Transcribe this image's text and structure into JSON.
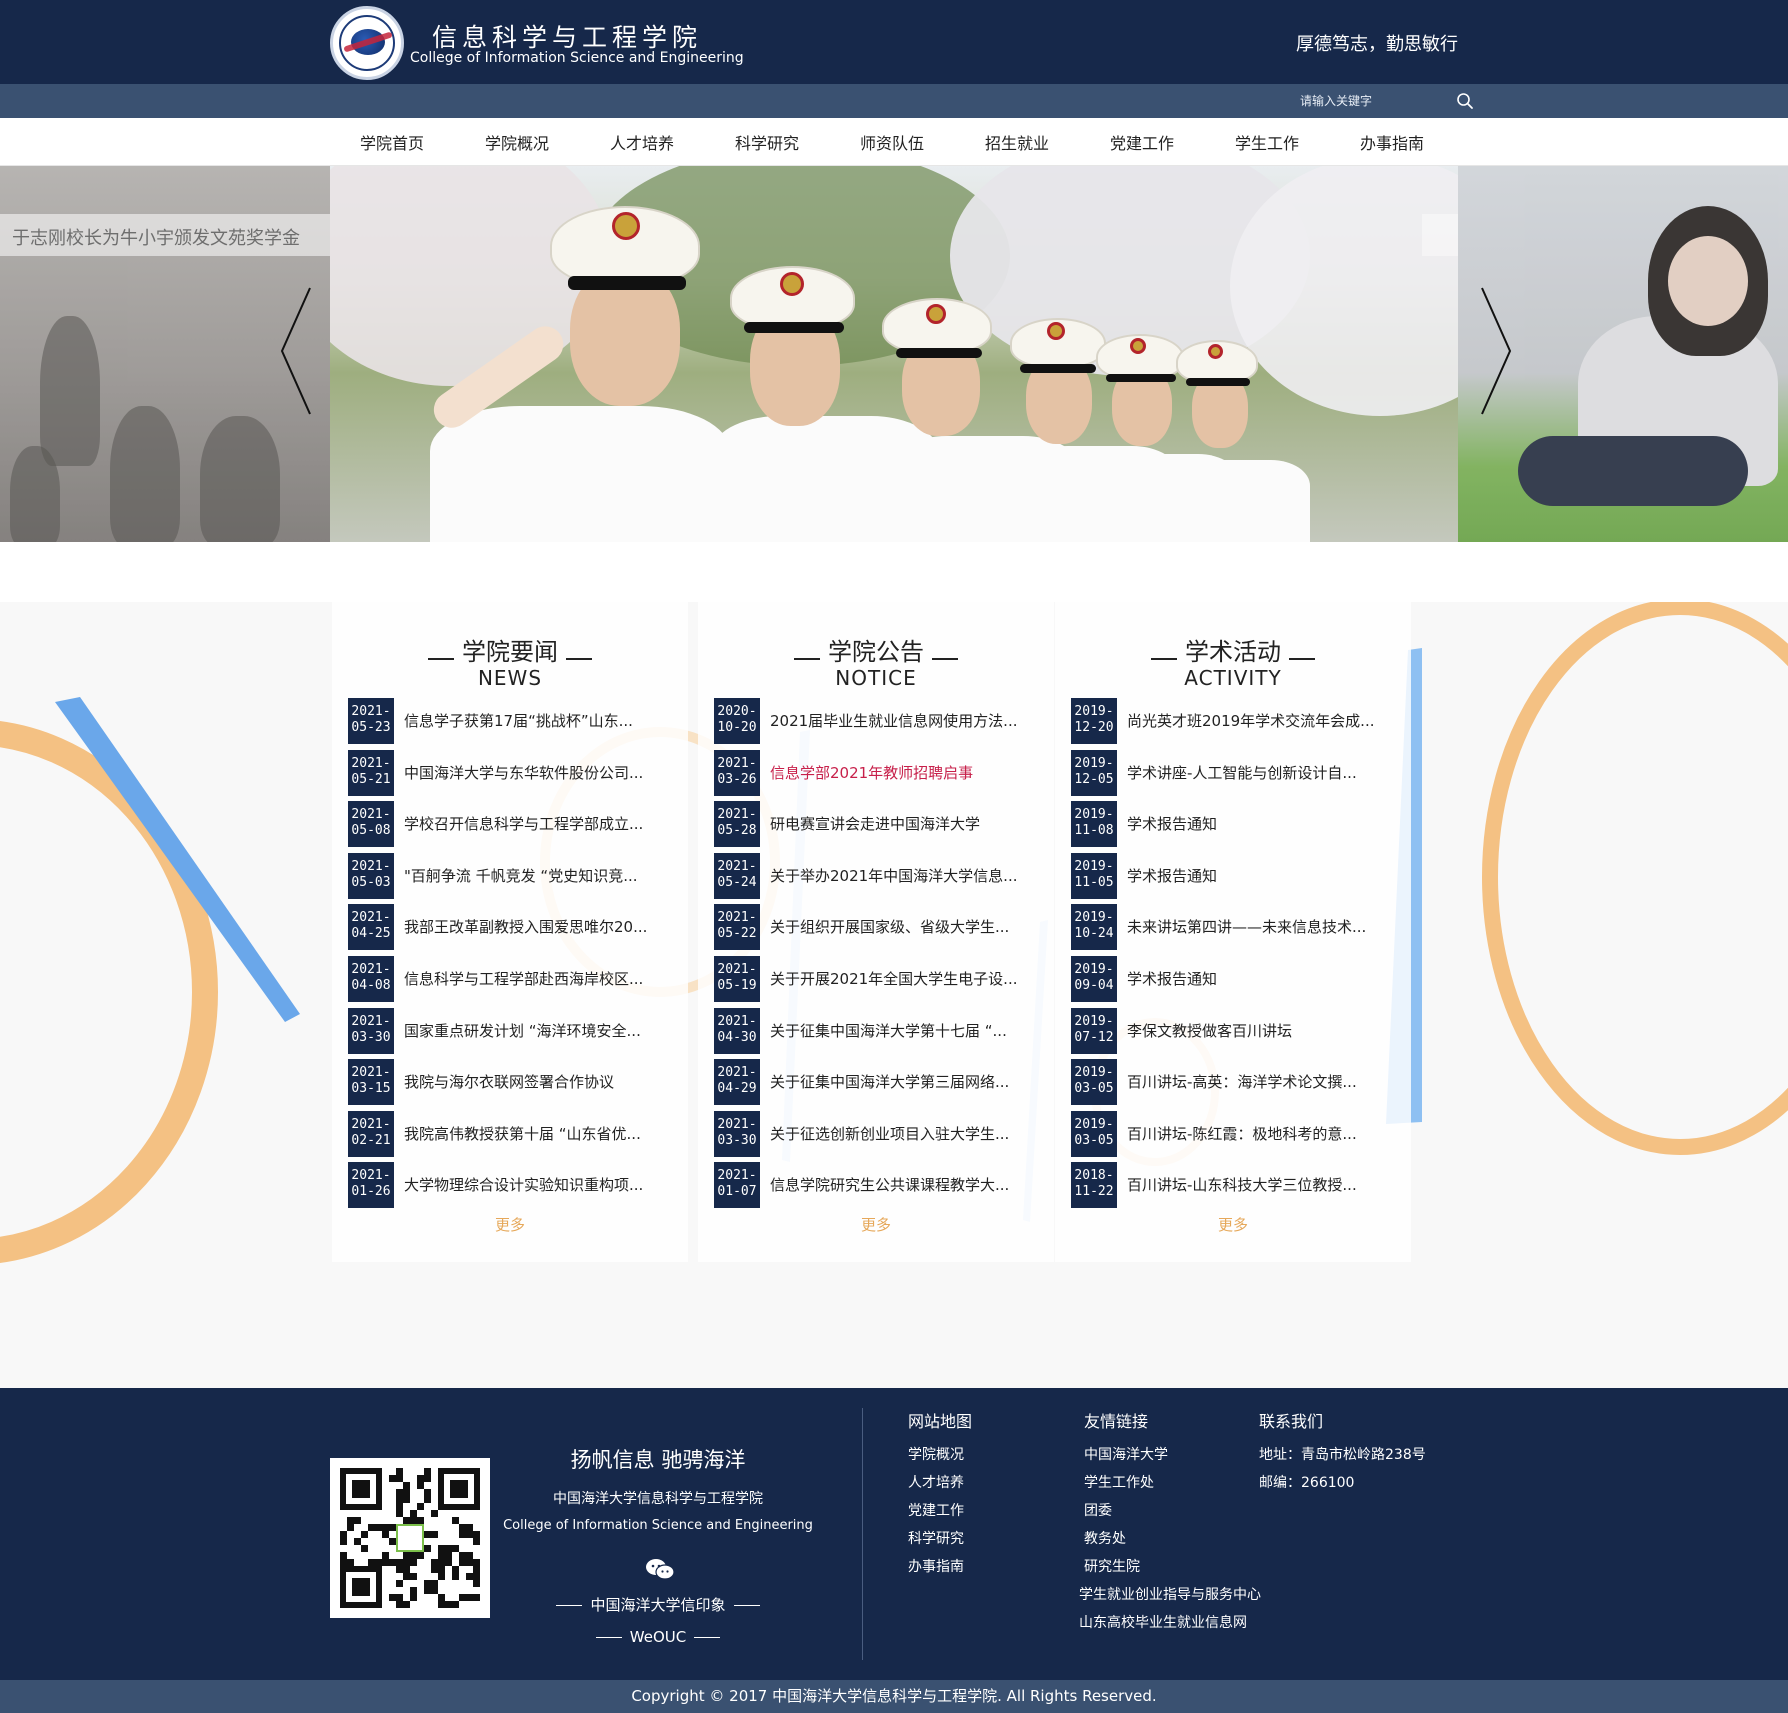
{
  "header": {
    "title_cn": "信息科学与工程学院",
    "title_en": "College of Information Science and Engineering",
    "motto": "厚德笃志，勤思敏行"
  },
  "search": {
    "placeholder": "请输入关键字"
  },
  "nav": [
    "学院首页",
    "学院概况",
    "人才培养",
    "科学研究",
    "师资队伍",
    "招生就业",
    "党建工作",
    "学生工作",
    "办事指南"
  ],
  "banner": {
    "caption": "于志刚校长为牛小宇颁发文苑奖学金"
  },
  "columns": [
    {
      "title": "学院要闻",
      "subtitle": "NEWS",
      "more": "更多",
      "items": [
        {
          "year": "2021-",
          "day": "05-23",
          "title": "信息学子获第17届“挑战杯”山东...",
          "highlight": false
        },
        {
          "year": "2021-",
          "day": "05-21",
          "title": "中国海洋大学与东华软件股份公司...",
          "highlight": false
        },
        {
          "year": "2021-",
          "day": "05-08",
          "title": "学校召开信息科学与工程学部成立...",
          "highlight": false
        },
        {
          "year": "2021-",
          "day": "05-03",
          "title": "\"百舸争流 千帆竞发 “党史知识竞...",
          "highlight": false
        },
        {
          "year": "2021-",
          "day": "04-25",
          "title": "我部王改革副教授入围爱思唯尔20...",
          "highlight": false
        },
        {
          "year": "2021-",
          "day": "04-08",
          "title": "信息科学与工程学部赴西海岸校区...",
          "highlight": false
        },
        {
          "year": "2021-",
          "day": "03-30",
          "title": "国家重点研发计划 “海洋环境安全...",
          "highlight": false
        },
        {
          "year": "2021-",
          "day": "03-15",
          "title": "我院与海尔衣联网签署合作协议",
          "highlight": false
        },
        {
          "year": "2021-",
          "day": "02-21",
          "title": "我院高伟教授获第十届 “山东省优...",
          "highlight": false
        },
        {
          "year": "2021-",
          "day": "01-26",
          "title": "大学物理综合设计实验知识重构项...",
          "highlight": false
        }
      ]
    },
    {
      "title": "学院公告",
      "subtitle": "NOTICE",
      "more": "更多",
      "items": [
        {
          "year": "2020-",
          "day": "10-20",
          "title": "2021届毕业生就业信息网使用方法...",
          "highlight": false
        },
        {
          "year": "2021-",
          "day": "03-26",
          "title": "信息学部2021年教师招聘启事",
          "highlight": true
        },
        {
          "year": "2021-",
          "day": "05-28",
          "title": "研电赛宣讲会走进中国海洋大学",
          "highlight": false
        },
        {
          "year": "2021-",
          "day": "05-24",
          "title": "关于举办2021年中国海洋大学信息...",
          "highlight": false
        },
        {
          "year": "2021-",
          "day": "05-22",
          "title": "关于组织开展国家级、省级大学生...",
          "highlight": false
        },
        {
          "year": "2021-",
          "day": "05-19",
          "title": "关于开展2021年全国大学生电子设...",
          "highlight": false
        },
        {
          "year": "2021-",
          "day": "04-30",
          "title": "关于征集中国海洋大学第十七届 “...",
          "highlight": false
        },
        {
          "year": "2021-",
          "day": "04-29",
          "title": "关于征集中国海洋大学第三届网络...",
          "highlight": false
        },
        {
          "year": "2021-",
          "day": "03-30",
          "title": "关于征选创新创业项目入驻大学生...",
          "highlight": false
        },
        {
          "year": "2021-",
          "day": "01-07",
          "title": "信息学院研究生公共课课程教学大...",
          "highlight": false
        }
      ]
    },
    {
      "title": "学术活动",
      "subtitle": "ACTIVITY",
      "more": "更多",
      "items": [
        {
          "year": "2019-",
          "day": "12-20",
          "title": "尚光英才班2019年学术交流年会成...",
          "highlight": false
        },
        {
          "year": "2019-",
          "day": "12-05",
          "title": "学术讲座-人工智能与创新设计自...",
          "highlight": false
        },
        {
          "year": "2019-",
          "day": "11-08",
          "title": "学术报告通知",
          "highlight": false
        },
        {
          "year": "2019-",
          "day": "11-05",
          "title": "学术报告通知",
          "highlight": false
        },
        {
          "year": "2019-",
          "day": "10-24",
          "title": "未来讲坛第四讲——未来信息技术...",
          "highlight": false
        },
        {
          "year": "2019-",
          "day": "09-04",
          "title": "学术报告通知",
          "highlight": false
        },
        {
          "year": "2019-",
          "day": "07-12",
          "title": "李保文教授做客百川讲坛",
          "highlight": false
        },
        {
          "year": "2019-",
          "day": "03-05",
          "title": "百川讲坛-高英：海洋学术论文撰...",
          "highlight": false
        },
        {
          "year": "2019-",
          "day": "03-05",
          "title": "百川讲坛-陈红霞：极地科考的意...",
          "highlight": false
        },
        {
          "year": "2018-",
          "day": "11-22",
          "title": "百川讲坛-山东科技大学三位教授...",
          "highlight": false
        }
      ]
    }
  ],
  "footer": {
    "slogan": "扬帆信息 驰骋海洋",
    "college_cn": "中国海洋大学信息科学与工程学院",
    "college_en": "College of Information Science and Engineering",
    "wechat_name": "中国海洋大学信印象",
    "wechat_id": "WeOUC",
    "sitemap": {
      "title": "网站地图",
      "links": [
        "学院概况",
        "人才培养",
        "党建工作",
        "科学研究",
        "办事指南"
      ]
    },
    "friends": {
      "title": "友情链接",
      "links": [
        "中国海洋大学",
        "学生工作处",
        "团委",
        "教务处",
        "研究生院",
        "学生就业创业指导与服务中心",
        "山东高校毕业生就业信息网"
      ]
    },
    "contact": {
      "title": "联系我们",
      "address": "地址：青岛市松岭路238号",
      "postcode": "邮编：266100"
    },
    "copyright": "Copyright © 2017 中国海洋大学信息科学与工程学院. All Rights Reserved."
  },
  "colors": {
    "navy": "#16284a",
    "slate": "#3a5171",
    "accent_orange": "#e6a85a",
    "highlight_red": "#c7204a",
    "deco_blue": "#6aa7ea"
  }
}
